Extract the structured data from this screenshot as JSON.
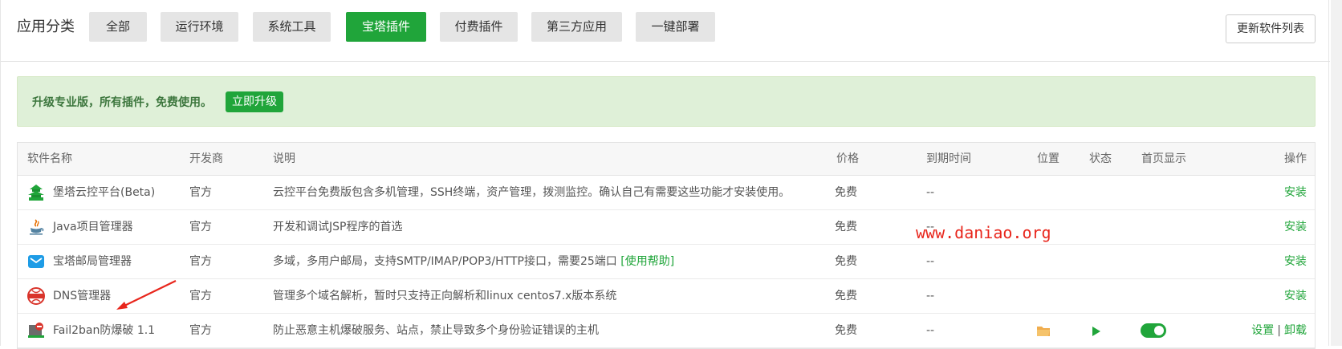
{
  "header": {
    "title": "应用分类",
    "categories": [
      "全部",
      "运行环境",
      "系统工具",
      "宝塔插件",
      "付费插件",
      "第三方应用",
      "一键部署"
    ],
    "active_index": 3,
    "refresh_label": "更新软件列表"
  },
  "banner": {
    "text": "升级专业版，所有插件，免费使用。",
    "button": "立即升级"
  },
  "table": {
    "headers": {
      "name": "软件名称",
      "dev": "开发商",
      "desc": "说明",
      "price": "价格",
      "expire": "到期时间",
      "location": "位置",
      "status": "状态",
      "home": "首页显示",
      "ops": "操作"
    },
    "rows": [
      {
        "name": "堡塔云控平台(Beta)",
        "dev": "官方",
        "desc": "云控平台免费版包含多机管理，SSH终端，资产管理，拨测监控。确认自己有需要这些功能才安装使用。",
        "price": "免费",
        "expire": "--",
        "op": "安装",
        "icon": "pagoda-icon"
      },
      {
        "name": "Java项目管理器",
        "dev": "官方",
        "desc": "开发和调试JSP程序的首选",
        "price": "免费",
        "expire": "--",
        "op": "安装",
        "icon": "java-icon"
      },
      {
        "name": "宝塔邮局管理器",
        "dev": "官方",
        "desc": "多域，多用户邮局，支持SMTP/IMAP/POP3/HTTP接口，需要25端口",
        "help": "[使用帮助]",
        "price": "免费",
        "expire": "--",
        "op": "安装",
        "icon": "mail-icon"
      },
      {
        "name": "DNS管理器",
        "dev": "官方",
        "desc": "管理多个域名解析，暂时只支持正向解析和linux centos7.x版本系统",
        "price": "免费",
        "expire": "--",
        "op": "安装",
        "icon": "dns-icon"
      },
      {
        "name": "Fail2ban防爆破 1.1",
        "dev": "官方",
        "desc": "防止恶意主机爆破服务、站点，禁止导致多个身份验证错误的主机",
        "price": "免费",
        "expire": "--",
        "op_settings": "设置",
        "op_sep": "|",
        "op_uninstall": "卸载",
        "icon": "fail2ban-icon"
      }
    ]
  },
  "watermark": "www.daniao.org",
  "colors": {
    "accent": "#20a53a",
    "banner_bg": "#dff0d8",
    "banner_text": "#3c763d",
    "folder": "#f0ad4e",
    "watermark": "#e8261c"
  }
}
